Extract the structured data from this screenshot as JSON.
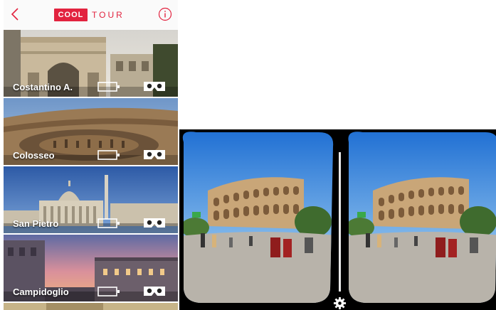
{
  "app": {
    "logo_cool": "COOL",
    "logo_tour": "TOUR",
    "back_icon": "chevron-left-icon",
    "info_icon": "info-icon",
    "accent": "#e2233f"
  },
  "tours": [
    {
      "label": "Costantino A."
    },
    {
      "label": "Colosseo"
    },
    {
      "label": "San Pietro"
    },
    {
      "label": "Campidoglio"
    }
  ],
  "vr": {
    "settings_icon": "gear-icon"
  }
}
